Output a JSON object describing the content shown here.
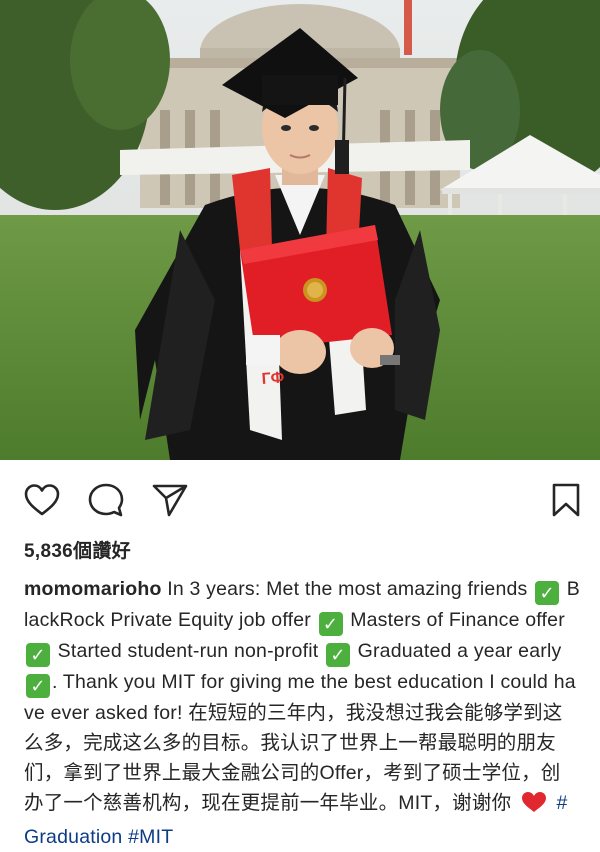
{
  "post": {
    "likes": "5,836個讚好",
    "username": "momomarioho",
    "caption_parts": [
      " In 3 years: Met the most amazing friends ",
      " BlackRock Private Equity job offer ",
      " Masters of Finance offer ",
      " Started student-run non-profit ",
      " Graduated a year early ",
      ". Thank you MIT for giving me the best education I could have ever asked for! 在短短的三年内，我没想过我会能够学到这么多，完成这么多的目标。我认识了世界上一帮最聪明的朋友们，拿到了世界上最大金融公司的Offer，考到了硕士学位，创办了一个慈善机构，现在更提前一年毕业。MIT，谢谢你 ",
      " "
    ],
    "check_glyph": "✓",
    "hashtags": [
      "#Graduation",
      "#MIT"
    ]
  },
  "icons": {
    "like": "heart-outline-icon",
    "comment": "comment-bubble-icon",
    "share": "paper-plane-icon",
    "save": "bookmark-icon",
    "emoji_check": "check-mark-emoji",
    "emoji_heart": "red-heart-emoji"
  },
  "colors": {
    "text": "#262626",
    "hashtag": "#0d3c85",
    "check_bg": "#4caf3e",
    "heart": "#e0282e",
    "gown_stole": "#e0342f"
  }
}
